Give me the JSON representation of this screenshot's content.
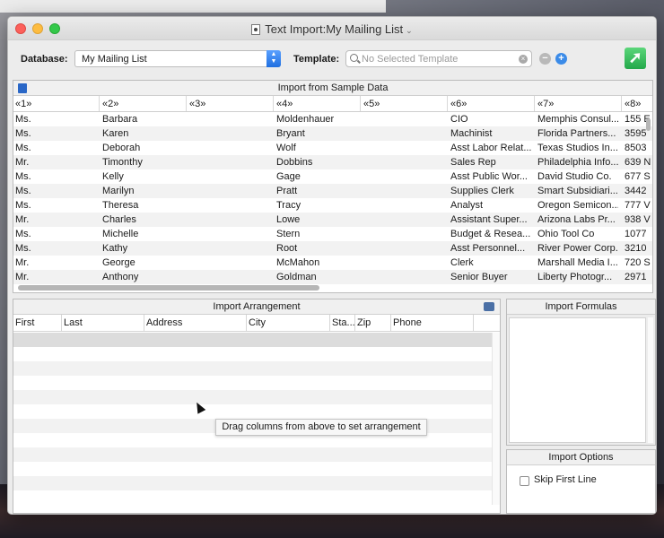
{
  "window": {
    "title": "Text Import:My Mailing List"
  },
  "toolbar": {
    "database_label": "Database:",
    "database_value": "My Mailing List",
    "template_label": "Template:",
    "template_placeholder": "No Selected Template",
    "remove_symbol": "−",
    "add_symbol": "+",
    "go_symbol": "➚"
  },
  "sample": {
    "title": "Import from Sample Data",
    "columns": [
      "«1»",
      "«2»",
      "«3»",
      "«4»",
      "«5»",
      "«6»",
      "«7»",
      "«8»"
    ],
    "rows": [
      [
        "Ms.",
        "Barbara",
        "",
        "Moldenhauer",
        "",
        "CIO",
        "Memphis Consul...",
        "155 E"
      ],
      [
        "Ms.",
        "Karen",
        "",
        "Bryant",
        "",
        "Machinist",
        "Florida Partners...",
        "3595"
      ],
      [
        "Ms.",
        "Deborah",
        "",
        "Wolf",
        "",
        "Asst Labor Relat...",
        "Texas Studios In...",
        "8503"
      ],
      [
        "Mr.",
        "Timonthy",
        "",
        "Dobbins",
        "",
        "Sales Rep",
        "Philadelphia Info...",
        "639 N"
      ],
      [
        "Ms.",
        "Kelly",
        "",
        "Gage",
        "",
        "Asst Public Wor...",
        "David Studio Co.",
        "677 S"
      ],
      [
        "Ms.",
        "Marilyn",
        "",
        "Pratt",
        "",
        "Supplies Clerk",
        "Smart Subsidiari...",
        "3442"
      ],
      [
        "Ms.",
        "Theresa",
        "",
        "Tracy",
        "",
        "Analyst",
        "Oregon Semicon...",
        "777 V"
      ],
      [
        "Mr.",
        "Charles",
        "",
        "Lowe",
        "",
        "Assistant Super...",
        "Arizona Labs Pr...",
        "938 V"
      ],
      [
        "Ms.",
        "Michelle",
        "",
        "Stern",
        "",
        "Budget & Resea...",
        "Ohio Tool Co",
        "1077"
      ],
      [
        "Ms.",
        "Kathy",
        "",
        "Root",
        "",
        "Asst Personnel...",
        "River Power Corp.",
        "3210"
      ],
      [
        "Mr.",
        "George",
        "",
        "McMahon",
        "",
        "Clerk",
        "Marshall Media I...",
        "720 S"
      ],
      [
        "Mr.",
        "Anthony",
        "",
        "Goldman",
        "",
        "Senior Buyer",
        "Liberty Photogr...",
        "2971"
      ]
    ]
  },
  "arrangement": {
    "title": "Import Arrangement",
    "columns": [
      "First",
      "Last",
      "Address",
      "City",
      "Sta...",
      "Zip",
      "Phone"
    ],
    "hint": "Drag columns from above to set arrangement"
  },
  "formulas": {
    "title": "Import Formulas"
  },
  "options": {
    "title": "Import Options",
    "skip_first_line_label": "Skip First Line",
    "skip_first_line_checked": false
  }
}
